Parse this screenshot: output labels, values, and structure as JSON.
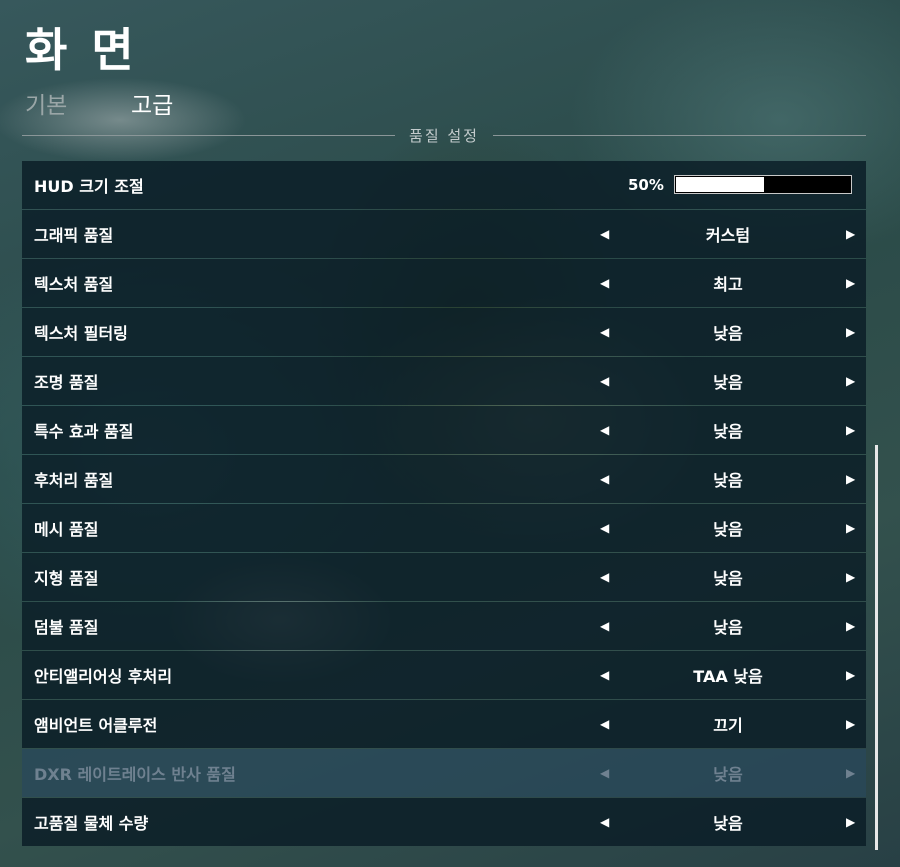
{
  "header": {
    "title": "화 면",
    "tabs": [
      {
        "label": "기본",
        "active": false
      },
      {
        "label": "고급",
        "active": true
      }
    ]
  },
  "section": {
    "title": "품질 설정"
  },
  "hud_scale": {
    "label": "HUD 크기 조절",
    "value_text": "50%",
    "value": 0.5
  },
  "settings": [
    {
      "label": "그래픽 품질",
      "value": "커스텀",
      "disabled": false
    },
    {
      "label": "텍스처 품질",
      "value": "최고",
      "disabled": false
    },
    {
      "label": "텍스처 필터링",
      "value": "낮음",
      "disabled": false
    },
    {
      "label": "조명 품질",
      "value": "낮음",
      "disabled": false
    },
    {
      "label": "특수 효과 품질",
      "value": "낮음",
      "disabled": false
    },
    {
      "label": "후처리 품질",
      "value": "낮음",
      "disabled": false
    },
    {
      "label": "메시 품질",
      "value": "낮음",
      "disabled": false
    },
    {
      "label": "지형 품질",
      "value": "낮음",
      "disabled": false
    },
    {
      "label": "덤불 품질",
      "value": "낮음",
      "disabled": false
    },
    {
      "label": "안티앨리어싱 후처리",
      "value": "TAA 낮음",
      "disabled": false
    },
    {
      "label": "앰비언트 어클루전",
      "value": "끄기",
      "disabled": false
    },
    {
      "label": "DXR 레이트레이스 반사 품질",
      "value": "낮음",
      "disabled": true
    },
    {
      "label": "고품질 물체 수량",
      "value": "낮음",
      "disabled": false
    }
  ],
  "icons": {
    "prev": "caret-left-icon",
    "next": "caret-right-icon"
  },
  "colors": {
    "row_bg": "#0a1c26",
    "disabled_row_bg": "#28485c",
    "disabled_text": "#6f8190"
  }
}
